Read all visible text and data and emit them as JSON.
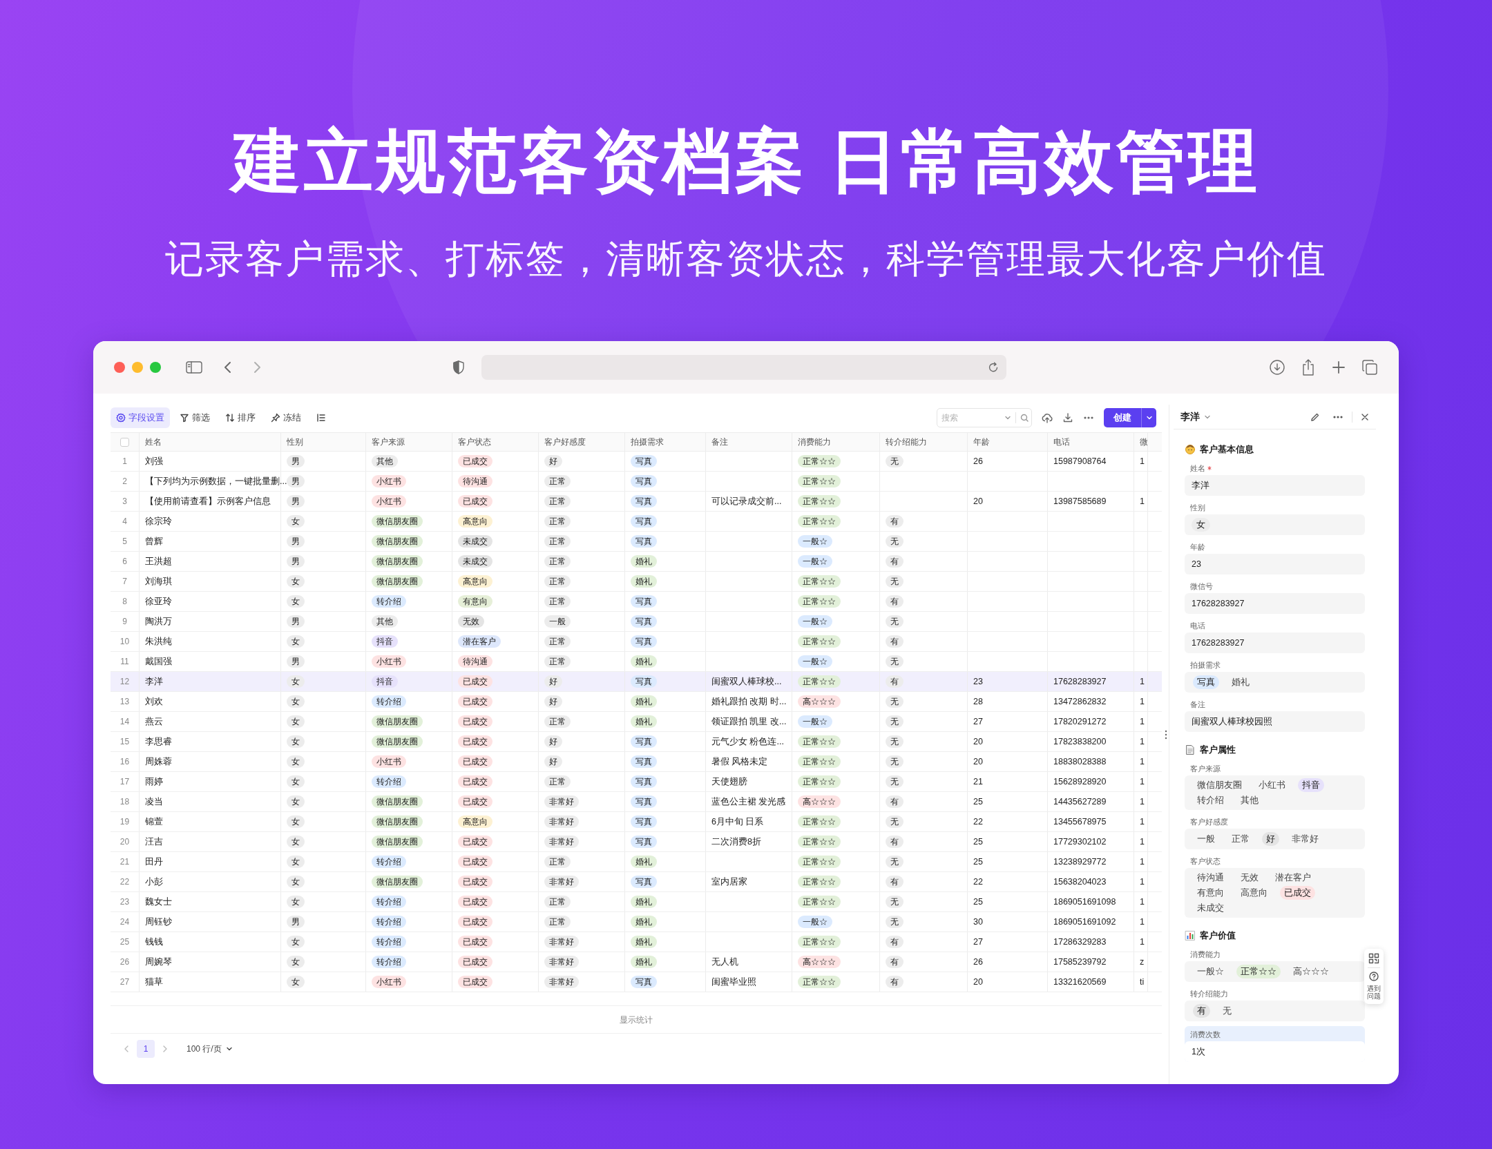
{
  "headline": {
    "title": "建立规范客资档案 日常高效管理",
    "subtitle": "记录客户需求、打标签，清晰客资状态，科学管理最大化客户价值"
  },
  "toolbar": {
    "tools": [
      {
        "kind": "gear",
        "label": "字段设置",
        "selected": true
      },
      {
        "kind": "filter",
        "label": "筛选",
        "selected": false
      },
      {
        "kind": "sort",
        "label": "排序",
        "selected": false
      },
      {
        "kind": "pin",
        "label": "冻结",
        "selected": false
      },
      {
        "kind": "list",
        "selected": false
      }
    ],
    "search": {
      "placeholder": "搜索"
    },
    "create_button": "创建"
  },
  "table": {
    "select_all": {
      "checked": false
    },
    "columns": [
      {
        "label": "姓名",
        "kind": "text"
      },
      {
        "label": "性别",
        "kind": "tag"
      },
      {
        "label": "客户来源",
        "kind": "tag"
      },
      {
        "label": "客户状态",
        "kind": "tag"
      },
      {
        "label": "客户好感度",
        "kind": "tag"
      },
      {
        "label": "拍摄需求",
        "kind": "tag"
      },
      {
        "label": "备注",
        "kind": "text"
      },
      {
        "label": "消费能力",
        "kind": "tag"
      },
      {
        "label": "转介绍能力",
        "kind": "tag"
      },
      {
        "label": "年龄",
        "kind": "text"
      },
      {
        "label": "电话",
        "kind": "text"
      },
      {
        "label": "微",
        "kind": "text"
      }
    ],
    "rows": [
      {
        "index": "1",
        "selected": false,
        "cells": [
          "刘强",
          {
            "text": "男",
            "color": "#ececec"
          },
          {
            "text": "其他",
            "color": "#ececec"
          },
          {
            "text": "已成交",
            "color": "#fde2e2"
          },
          {
            "text": "好",
            "color": "#ececec"
          },
          {
            "text": "写真",
            "color": "#dbeafe"
          },
          null,
          {
            "text": "正常☆☆",
            "color": "#e2f0d9"
          },
          {
            "text": "无",
            "color": "#ececec"
          },
          "26",
          "15987908764",
          "1"
        ]
      },
      {
        "index": "2",
        "selected": false,
        "cells": [
          "【下列均为示例数据，一键批量删...",
          {
            "text": "男",
            "color": "#ececec"
          },
          {
            "text": "小红书",
            "color": "#fde2e2"
          },
          {
            "text": "待沟通",
            "color": "#fde2e2"
          },
          {
            "text": "正常",
            "color": "#ececec"
          },
          {
            "text": "写真",
            "color": "#dbeafe"
          },
          null,
          {
            "text": "正常☆☆",
            "color": "#e2f0d9"
          },
          null,
          null,
          null,
          null
        ]
      },
      {
        "index": "3",
        "selected": false,
        "cells": [
          "【使用前请查看】示例客户信息",
          {
            "text": "男",
            "color": "#ececec"
          },
          {
            "text": "小红书",
            "color": "#fde2e2"
          },
          {
            "text": "已成交",
            "color": "#fde2e2"
          },
          {
            "text": "正常",
            "color": "#ececec"
          },
          {
            "text": "写真",
            "color": "#dbeafe"
          },
          "可以记录成交前...",
          {
            "text": "正常☆☆",
            "color": "#e2f0d9"
          },
          null,
          "20",
          "13987585689",
          "1"
        ]
      },
      {
        "index": "4",
        "selected": false,
        "cells": [
          "徐宗玲",
          {
            "text": "女",
            "color": "#ececec"
          },
          {
            "text": "微信朋友圈",
            "color": "#e2f0d9"
          },
          {
            "text": "高意向",
            "color": "#fdf1d2"
          },
          {
            "text": "正常",
            "color": "#ececec"
          },
          {
            "text": "写真",
            "color": "#dbeafe"
          },
          null,
          {
            "text": "正常☆☆",
            "color": "#e2f0d9"
          },
          {
            "text": "有",
            "color": "#ececec"
          },
          null,
          null,
          null
        ]
      },
      {
        "index": "5",
        "selected": false,
        "cells": [
          "曾辉",
          {
            "text": "男",
            "color": "#ececec"
          },
          {
            "text": "微信朋友圈",
            "color": "#e2f0d9"
          },
          {
            "text": "未成交",
            "color": "#e4e4e4"
          },
          {
            "text": "正常",
            "color": "#ececec"
          },
          {
            "text": "写真",
            "color": "#dbeafe"
          },
          null,
          {
            "text": "一般☆",
            "color": "#dbeafe"
          },
          {
            "text": "无",
            "color": "#ececec"
          },
          null,
          null,
          null
        ]
      },
      {
        "index": "6",
        "selected": false,
        "cells": [
          "王洪超",
          {
            "text": "男",
            "color": "#ececec"
          },
          {
            "text": "微信朋友圈",
            "color": "#e2f0d9"
          },
          {
            "text": "未成交",
            "color": "#e4e4e4"
          },
          {
            "text": "正常",
            "color": "#ececec"
          },
          {
            "text": "婚礼",
            "color": "#e2f0d9"
          },
          null,
          {
            "text": "一般☆",
            "color": "#dbeafe"
          },
          {
            "text": "有",
            "color": "#ececec"
          },
          null,
          null,
          null
        ]
      },
      {
        "index": "7",
        "selected": false,
        "cells": [
          "刘海琪",
          {
            "text": "女",
            "color": "#ececec"
          },
          {
            "text": "微信朋友圈",
            "color": "#e2f0d9"
          },
          {
            "text": "高意向",
            "color": "#fdf1d2"
          },
          {
            "text": "正常",
            "color": "#ececec"
          },
          {
            "text": "婚礼",
            "color": "#e2f0d9"
          },
          null,
          {
            "text": "正常☆☆",
            "color": "#e2f0d9"
          },
          {
            "text": "无",
            "color": "#ececec"
          },
          null,
          null,
          null
        ]
      },
      {
        "index": "8",
        "selected": false,
        "cells": [
          "徐亚玲",
          {
            "text": "女",
            "color": "#ececec"
          },
          {
            "text": "转介绍",
            "color": "#dbeafe"
          },
          {
            "text": "有意向",
            "color": "#e6efd8"
          },
          {
            "text": "正常",
            "color": "#ececec"
          },
          {
            "text": "写真",
            "color": "#dbeafe"
          },
          null,
          {
            "text": "正常☆☆",
            "color": "#e2f0d9"
          },
          {
            "text": "有",
            "color": "#ececec"
          },
          null,
          null,
          null
        ]
      },
      {
        "index": "9",
        "selected": false,
        "cells": [
          "陶洪万",
          {
            "text": "男",
            "color": "#ececec"
          },
          {
            "text": "其他",
            "color": "#ececec"
          },
          {
            "text": "无效",
            "color": "#e4e4e4"
          },
          {
            "text": "一般",
            "color": "#ececec"
          },
          {
            "text": "写真",
            "color": "#dbeafe"
          },
          null,
          {
            "text": "一般☆",
            "color": "#dbeafe"
          },
          {
            "text": "无",
            "color": "#ececec"
          },
          null,
          null,
          null
        ]
      },
      {
        "index": "10",
        "selected": false,
        "cells": [
          "朱洪纯",
          {
            "text": "女",
            "color": "#ececec"
          },
          {
            "text": "抖音",
            "color": "#e6e1fb"
          },
          {
            "text": "潜在客户",
            "color": "#dde7fb"
          },
          {
            "text": "正常",
            "color": "#ececec"
          },
          {
            "text": "写真",
            "color": "#dbeafe"
          },
          null,
          {
            "text": "正常☆☆",
            "color": "#e2f0d9"
          },
          {
            "text": "有",
            "color": "#ececec"
          },
          null,
          null,
          null
        ]
      },
      {
        "index": "11",
        "selected": false,
        "cells": [
          "戴国强",
          {
            "text": "男",
            "color": "#ececec"
          },
          {
            "text": "小红书",
            "color": "#fde2e2"
          },
          {
            "text": "待沟通",
            "color": "#fde2e2"
          },
          {
            "text": "正常",
            "color": "#ececec"
          },
          {
            "text": "婚礼",
            "color": "#e2f0d9"
          },
          null,
          {
            "text": "一般☆",
            "color": "#dbeafe"
          },
          {
            "text": "无",
            "color": "#ececec"
          },
          null,
          null,
          null
        ]
      },
      {
        "index": "12",
        "selected": true,
        "cells": [
          "李洋",
          {
            "text": "女",
            "color": "#ececec"
          },
          {
            "text": "抖音",
            "color": "#e6e1fb"
          },
          {
            "text": "已成交",
            "color": "#fde2e2"
          },
          {
            "text": "好",
            "color": "#ececec"
          },
          {
            "text": "写真",
            "color": "#dbeafe"
          },
          "闺蜜双人棒球校...",
          {
            "text": "正常☆☆",
            "color": "#e2f0d9"
          },
          {
            "text": "有",
            "color": "#ececec"
          },
          "23",
          "17628283927",
          "1"
        ]
      },
      {
        "index": "13",
        "selected": false,
        "cells": [
          "刘欢",
          {
            "text": "女",
            "color": "#ececec"
          },
          {
            "text": "转介绍",
            "color": "#dbeafe"
          },
          {
            "text": "已成交",
            "color": "#fde2e2"
          },
          {
            "text": "好",
            "color": "#ececec"
          },
          {
            "text": "婚礼",
            "color": "#e2f0d9"
          },
          "婚礼跟拍 改期 时...",
          {
            "text": "高☆☆☆",
            "color": "#fde2e2"
          },
          {
            "text": "无",
            "color": "#ececec"
          },
          "28",
          "13472862832",
          "1"
        ]
      },
      {
        "index": "14",
        "selected": false,
        "cells": [
          "燕云",
          {
            "text": "女",
            "color": "#ececec"
          },
          {
            "text": "微信朋友圈",
            "color": "#e2f0d9"
          },
          {
            "text": "已成交",
            "color": "#fde2e2"
          },
          {
            "text": "正常",
            "color": "#ececec"
          },
          {
            "text": "婚礼",
            "color": "#e2f0d9"
          },
          "领证跟拍 凯里 改...",
          {
            "text": "一般☆",
            "color": "#dbeafe"
          },
          {
            "text": "无",
            "color": "#ececec"
          },
          "27",
          "17820291272",
          "1"
        ]
      },
      {
        "index": "15",
        "selected": false,
        "cells": [
          "李思睿",
          {
            "text": "女",
            "color": "#ececec"
          },
          {
            "text": "微信朋友圈",
            "color": "#e2f0d9"
          },
          {
            "text": "已成交",
            "color": "#fde2e2"
          },
          {
            "text": "好",
            "color": "#ececec"
          },
          {
            "text": "写真",
            "color": "#dbeafe"
          },
          "元气少女 粉色连...",
          {
            "text": "正常☆☆",
            "color": "#e2f0d9"
          },
          {
            "text": "无",
            "color": "#ececec"
          },
          "20",
          "17823838200",
          "1"
        ]
      },
      {
        "index": "16",
        "selected": false,
        "cells": [
          "周姝蓉",
          {
            "text": "女",
            "color": "#ececec"
          },
          {
            "text": "小红书",
            "color": "#fde2e2"
          },
          {
            "text": "已成交",
            "color": "#fde2e2"
          },
          {
            "text": "好",
            "color": "#ececec"
          },
          {
            "text": "写真",
            "color": "#dbeafe"
          },
          "暑假 风格未定",
          {
            "text": "正常☆☆",
            "color": "#e2f0d9"
          },
          {
            "text": "无",
            "color": "#ececec"
          },
          "20",
          "18838028388",
          "1"
        ]
      },
      {
        "index": "17",
        "selected": false,
        "cells": [
          "雨婷",
          {
            "text": "女",
            "color": "#ececec"
          },
          {
            "text": "转介绍",
            "color": "#dbeafe"
          },
          {
            "text": "已成交",
            "color": "#fde2e2"
          },
          {
            "text": "正常",
            "color": "#ececec"
          },
          {
            "text": "写真",
            "color": "#dbeafe"
          },
          "天使翅膀",
          {
            "text": "正常☆☆",
            "color": "#e2f0d9"
          },
          {
            "text": "无",
            "color": "#ececec"
          },
          "21",
          "15628928920",
          "1"
        ]
      },
      {
        "index": "18",
        "selected": false,
        "cells": [
          "凌当",
          {
            "text": "女",
            "color": "#ececec"
          },
          {
            "text": "微信朋友圈",
            "color": "#e2f0d9"
          },
          {
            "text": "已成交",
            "color": "#fde2e2"
          },
          {
            "text": "非常好",
            "color": "#ececec"
          },
          {
            "text": "写真",
            "color": "#dbeafe"
          },
          "蓝色公主裙 发光感",
          {
            "text": "高☆☆☆",
            "color": "#fde2e2"
          },
          {
            "text": "有",
            "color": "#ececec"
          },
          "25",
          "14435627289",
          "1"
        ]
      },
      {
        "index": "19",
        "selected": false,
        "cells": [
          "锦萱",
          {
            "text": "女",
            "color": "#ececec"
          },
          {
            "text": "微信朋友圈",
            "color": "#e2f0d9"
          },
          {
            "text": "高意向",
            "color": "#fdf1d2"
          },
          {
            "text": "非常好",
            "color": "#ececec"
          },
          {
            "text": "写真",
            "color": "#dbeafe"
          },
          "6月中旬 日系",
          {
            "text": "正常☆☆",
            "color": "#e2f0d9"
          },
          {
            "text": "无",
            "color": "#ececec"
          },
          "22",
          "13455678975",
          "1"
        ]
      },
      {
        "index": "20",
        "selected": false,
        "cells": [
          "汪吉",
          {
            "text": "女",
            "color": "#ececec"
          },
          {
            "text": "微信朋友圈",
            "color": "#e2f0d9"
          },
          {
            "text": "已成交",
            "color": "#fde2e2"
          },
          {
            "text": "非常好",
            "color": "#ececec"
          },
          {
            "text": "写真",
            "color": "#dbeafe"
          },
          "二次消费8折",
          {
            "text": "正常☆☆",
            "color": "#e2f0d9"
          },
          {
            "text": "有",
            "color": "#ececec"
          },
          "25",
          "17729302102",
          "1"
        ]
      },
      {
        "index": "21",
        "selected": false,
        "cells": [
          "田丹",
          {
            "text": "女",
            "color": "#ececec"
          },
          {
            "text": "转介绍",
            "color": "#dbeafe"
          },
          {
            "text": "已成交",
            "color": "#fde2e2"
          },
          {
            "text": "正常",
            "color": "#ececec"
          },
          {
            "text": "婚礼",
            "color": "#e2f0d9"
          },
          null,
          {
            "text": "正常☆☆",
            "color": "#e2f0d9"
          },
          {
            "text": "无",
            "color": "#ececec"
          },
          "25",
          "13238929772",
          "1"
        ]
      },
      {
        "index": "22",
        "selected": false,
        "cells": [
          "小彭",
          {
            "text": "女",
            "color": "#ececec"
          },
          {
            "text": "微信朋友圈",
            "color": "#e2f0d9"
          },
          {
            "text": "已成交",
            "color": "#fde2e2"
          },
          {
            "text": "非常好",
            "color": "#ececec"
          },
          {
            "text": "写真",
            "color": "#dbeafe"
          },
          "室内居家",
          {
            "text": "正常☆☆",
            "color": "#e2f0d9"
          },
          {
            "text": "有",
            "color": "#ececec"
          },
          "22",
          "15638204023",
          "1"
        ]
      },
      {
        "index": "23",
        "selected": false,
        "cells": [
          "魏女士",
          {
            "text": "女",
            "color": "#ececec"
          },
          {
            "text": "转介绍",
            "color": "#dbeafe"
          },
          {
            "text": "已成交",
            "color": "#fde2e2"
          },
          {
            "text": "正常",
            "color": "#ececec"
          },
          {
            "text": "婚礼",
            "color": "#e2f0d9"
          },
          null,
          {
            "text": "正常☆☆",
            "color": "#e2f0d9"
          },
          {
            "text": "无",
            "color": "#ececec"
          },
          "25",
          "1869051691098",
          "1"
        ]
      },
      {
        "index": "24",
        "selected": false,
        "cells": [
          "周钰钞",
          {
            "text": "男",
            "color": "#ececec"
          },
          {
            "text": "转介绍",
            "color": "#dbeafe"
          },
          {
            "text": "已成交",
            "color": "#fde2e2"
          },
          {
            "text": "正常",
            "color": "#ececec"
          },
          {
            "text": "婚礼",
            "color": "#e2f0d9"
          },
          null,
          {
            "text": "一般☆",
            "color": "#dbeafe"
          },
          {
            "text": "无",
            "color": "#ececec"
          },
          "30",
          "1869051691092",
          "1"
        ]
      },
      {
        "index": "25",
        "selected": false,
        "cells": [
          "钱钱",
          {
            "text": "女",
            "color": "#ececec"
          },
          {
            "text": "转介绍",
            "color": "#dbeafe"
          },
          {
            "text": "已成交",
            "color": "#fde2e2"
          },
          {
            "text": "非常好",
            "color": "#ececec"
          },
          {
            "text": "婚礼",
            "color": "#e2f0d9"
          },
          null,
          {
            "text": "正常☆☆",
            "color": "#e2f0d9"
          },
          {
            "text": "有",
            "color": "#ececec"
          },
          "27",
          "17286329283",
          "1"
        ]
      },
      {
        "index": "26",
        "selected": false,
        "cells": [
          "周婉琴",
          {
            "text": "女",
            "color": "#ececec"
          },
          {
            "text": "转介绍",
            "color": "#dbeafe"
          },
          {
            "text": "已成交",
            "color": "#fde2e2"
          },
          {
            "text": "非常好",
            "color": "#ececec"
          },
          {
            "text": "婚礼",
            "color": "#e2f0d9"
          },
          "无人机",
          {
            "text": "高☆☆☆",
            "color": "#fde2e2"
          },
          {
            "text": "有",
            "color": "#ececec"
          },
          "26",
          "17585239792",
          "z"
        ]
      },
      {
        "index": "27",
        "selected": false,
        "cells": [
          "猫草",
          {
            "text": "女",
            "color": "#ececec"
          },
          {
            "text": "小红书",
            "color": "#fde2e2"
          },
          {
            "text": "已成交",
            "color": "#fde2e2"
          },
          {
            "text": "非常好",
            "color": "#ececec"
          },
          {
            "text": "写真",
            "color": "#dbeafe"
          },
          "闺蜜毕业照",
          {
            "text": "正常☆☆",
            "color": "#e2f0d9"
          },
          {
            "text": "有",
            "color": "#ececec"
          },
          "20",
          "13321620569",
          "ti"
        ]
      }
    ],
    "statistics": "显示统计"
  },
  "pagination": {
    "pages": [
      {
        "label": "1",
        "selected": true
      }
    ],
    "page_size": "100 行/页"
  },
  "detail_panel": {
    "title": "李洋",
    "sections": [
      {
        "title": "客户基本信息",
        "kind": "person",
        "fields": [
          {
            "label": "姓名",
            "kind": "text",
            "required": true,
            "value": "李洋"
          },
          {
            "label": "性别",
            "kind": "tag",
            "value": {
              "text": "女",
              "color": "#ececec"
            }
          },
          {
            "label": "年龄",
            "kind": "text",
            "value": "23"
          },
          {
            "label": "微信号",
            "kind": "text",
            "value": "17628283927"
          },
          {
            "label": "电话",
            "kind": "text",
            "value": "17628283927"
          },
          {
            "label": "拍摄需求",
            "kind": "options",
            "options": [
              {
                "text": "写真",
                "selected": true,
                "color": "#dbeafe"
              },
              {
                "text": "婚礼",
                "selected": false
              }
            ]
          },
          {
            "label": "备注",
            "kind": "text",
            "value": "闺蜜双人棒球校园照"
          }
        ]
      },
      {
        "title": "客户属性",
        "kind": "document",
        "fields": [
          {
            "label": "客户来源",
            "kind": "options",
            "options": [
              {
                "text": "微信朋友圈",
                "selected": false
              },
              {
                "text": "小红书",
                "selected": false
              },
              {
                "text": "抖音",
                "selected": true,
                "color": "#e6e1fb"
              },
              {
                "text": "转介绍",
                "selected": false
              },
              {
                "text": "其他",
                "selected": false
              }
            ]
          },
          {
            "label": "客户好感度",
            "kind": "options",
            "options": [
              {
                "text": "一般",
                "selected": false
              },
              {
                "text": "正常",
                "selected": false
              },
              {
                "text": "好",
                "selected": true,
                "color": "#e4e4e4"
              },
              {
                "text": "非常好",
                "selected": false
              }
            ]
          },
          {
            "label": "客户状态",
            "kind": "options",
            "options": [
              {
                "text": "待沟通",
                "selected": false
              },
              {
                "text": "无效",
                "selected": false
              },
              {
                "text": "潜在客户",
                "selected": false
              },
              {
                "text": "有意向",
                "selected": false
              },
              {
                "text": "高意向",
                "selected": false
              },
              {
                "text": "已成交",
                "selected": true,
                "color": "#fde2e2"
              },
              {
                "text": "未成交",
                "selected": false
              }
            ]
          }
        ]
      },
      {
        "title": "客户价值",
        "kind": "chart",
        "fields": [
          {
            "label": "消费能力",
            "kind": "options",
            "options": [
              {
                "text": "一般☆",
                "selected": false
              },
              {
                "text": "正常☆☆",
                "selected": true,
                "color": "#e2f0d9"
              },
              {
                "text": "高☆☆☆",
                "selected": false
              }
            ]
          },
          {
            "label": "转介绍能力",
            "kind": "options",
            "options": [
              {
                "text": "有",
                "selected": true,
                "color": "#e4e4e4"
              },
              {
                "text": "无",
                "selected": false
              }
            ]
          },
          {
            "label": "消费次数",
            "kind": "text",
            "focused": true,
            "value": "1次"
          }
        ]
      }
    ]
  },
  "help_widget": {
    "label": "遇到问题"
  }
}
